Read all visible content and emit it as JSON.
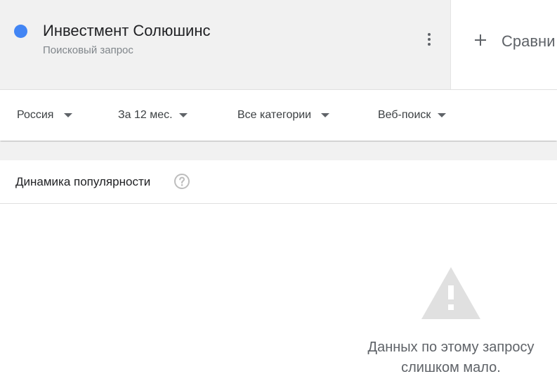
{
  "search_term": {
    "title": "Инвестмент Солюшинс",
    "subtitle": "Поисковый запрос",
    "color": "#4285f4",
    "menu_icon": "more-vert-icon"
  },
  "compare": {
    "icon": "plus-icon",
    "label": "Сравни"
  },
  "filters": [
    {
      "label": "Россия",
      "icon": "caret-down-icon"
    },
    {
      "label": "За 12 мес.",
      "icon": "caret-down-icon"
    },
    {
      "label": "Все категории",
      "icon": "caret-down-icon"
    },
    {
      "label": "Веб-поиск",
      "icon": "caret-down-icon"
    }
  ],
  "interest_over_time": {
    "title": "Динамика популярности",
    "help_icon": "help-circle-icon",
    "empty_icon": "warning-icon",
    "empty_message_line1": "Данных по этому запросу",
    "empty_message_line2": "слишком мало."
  },
  "colors": {
    "accent_blue": "#4285f4",
    "header_bg": "#f1f1f1",
    "warning_icon": "#e0e0e0"
  }
}
